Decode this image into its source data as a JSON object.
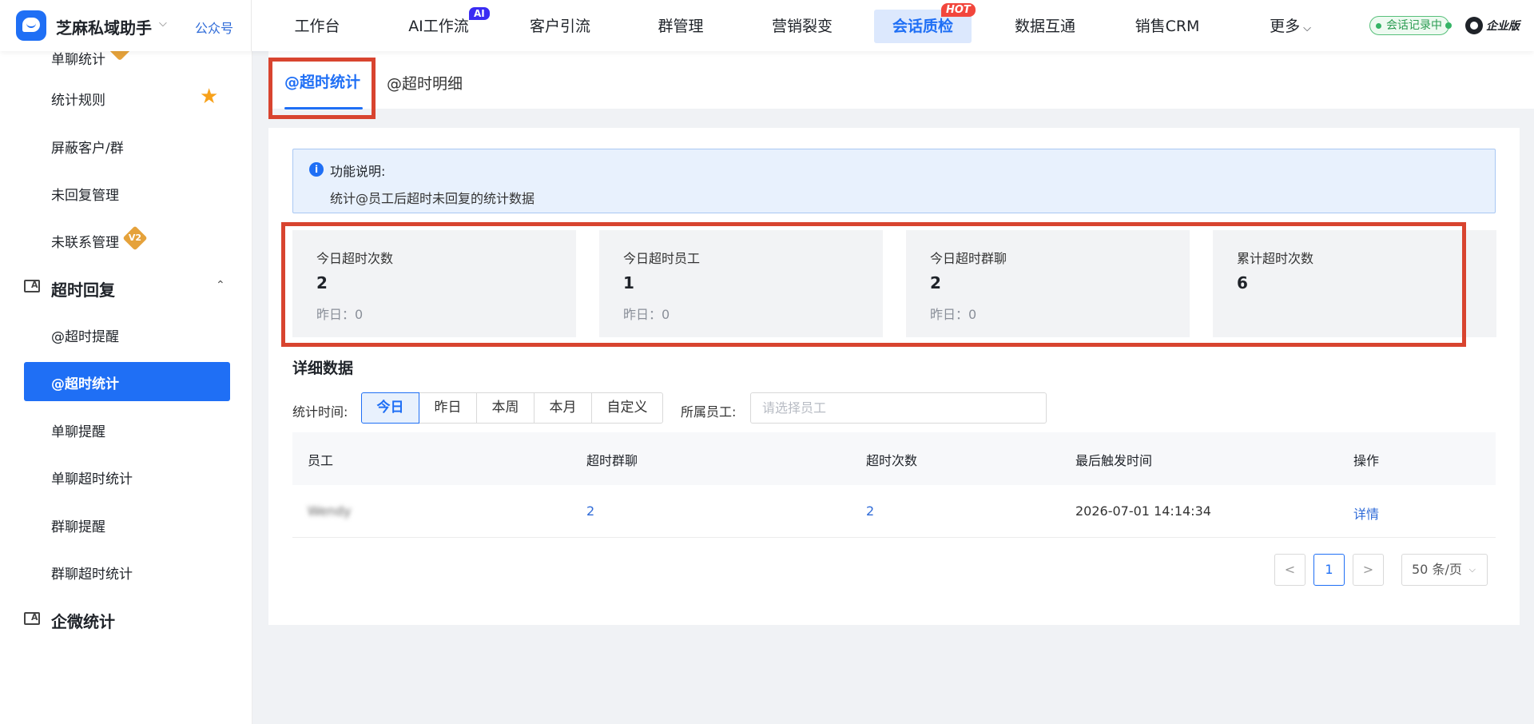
{
  "header": {
    "brand": "芝麻私域助手",
    "official_account": "公众号",
    "nav": [
      {
        "label": "工作台"
      },
      {
        "label": "AI工作流",
        "badge": "AI"
      },
      {
        "label": "客户引流"
      },
      {
        "label": "群管理"
      },
      {
        "label": "营销裂变"
      },
      {
        "label": "会话质检",
        "badge": "HOT",
        "active": true
      },
      {
        "label": "数据互通"
      },
      {
        "label": "销售CRM"
      },
      {
        "label": "更多"
      }
    ],
    "recording_status": "会话记录中",
    "edition": "企业版"
  },
  "sidebar": {
    "items": [
      {
        "label": "单聊统计"
      },
      {
        "label": "统计规则"
      },
      {
        "label": "屏蔽客户/群"
      },
      {
        "label": "未回复管理"
      },
      {
        "label": "未联系管理",
        "badge": "V2"
      }
    ],
    "group_timeout": {
      "title": "超时回复",
      "items": [
        {
          "label": "@超时提醒"
        },
        {
          "label": "@超时统计",
          "active": true
        },
        {
          "label": "单聊提醒"
        },
        {
          "label": "单聊超时统计"
        },
        {
          "label": "群聊提醒"
        },
        {
          "label": "群聊超时统计"
        }
      ]
    },
    "group_wecom": {
      "title": "企微统计"
    }
  },
  "tabs": [
    {
      "label": "@超时统计",
      "active": true
    },
    {
      "label": "@超时明细"
    }
  ],
  "notice": {
    "title": "功能说明:",
    "text": "统计@员工后超时未回复的统计数据"
  },
  "stats": [
    {
      "label": "今日超时次数",
      "value": "2",
      "yesterday": "昨日：0"
    },
    {
      "label": "今日超时员工",
      "value": "1",
      "yesterday": "昨日：0"
    },
    {
      "label": "今日超时群聊",
      "value": "2",
      "yesterday": "昨日：0"
    },
    {
      "label": "累计超时次数",
      "value": "6"
    }
  ],
  "detail": {
    "title": "详细数据",
    "filter_time_label": "统计时间:",
    "time_options": [
      "今日",
      "昨日",
      "本周",
      "本月",
      "自定义"
    ],
    "selected_time": "今日",
    "employee_label": "所属员工:",
    "employee_placeholder": "请选择员工"
  },
  "table": {
    "columns": [
      "员工",
      "超时群聊",
      "超时次数",
      "最后触发时间",
      "操作"
    ],
    "rows": [
      {
        "employee": "Wendy",
        "timeout_groups": "2",
        "timeout_count": "2",
        "last_trigger": "2026-07-01 14:14:34",
        "action": "详情"
      }
    ]
  },
  "pagination": {
    "prev": "<",
    "current_page": "1",
    "next": ">",
    "page_size": "50 条/页"
  }
}
